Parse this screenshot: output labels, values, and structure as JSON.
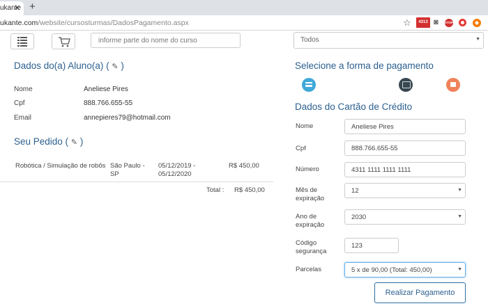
{
  "browser": {
    "tab_title": "ukante",
    "url_host": "ukante.com",
    "url_path": "/website/cursosturmas/DadosPagamento.aspx",
    "mail_badge": "4313"
  },
  "toolbar": {
    "search_placeholder": "informe parte do nome do curso",
    "filter_value": "Todos"
  },
  "student": {
    "title": "Dados do(a) Aluno(a) (",
    "title_end": ")",
    "name_label": "Nome",
    "name_value": "Aneliese Pires",
    "cpf_label": "Cpf",
    "cpf_value": "888.766.655-55",
    "email_label": "Email",
    "email_value": "annepieres79@hotmail.com"
  },
  "order": {
    "title": "Seu Pedido (",
    "title_end": ")",
    "course": "Robótica / Simulação de robôs",
    "city": "São Paulo - SP",
    "period": "05/12/2019 - 05/12/2020",
    "price": "R$ 450,00",
    "total_label": "Total :",
    "total_value": "R$ 450,00"
  },
  "payment": {
    "select_title": "Selecione a forma de pagamento",
    "card_title": "Dados do Cartão de Crédito",
    "name_label": "Nome",
    "name_value": "Aneliese Pires",
    "cpf_label": "Cpf",
    "cpf_value": "888.766.655-55",
    "number_label": "Número",
    "number_value": "4311 1111 1111 1111",
    "month_label": "Mês de expiração",
    "month_value": "12",
    "year_label": "Ano de expiração",
    "year_value": "2030",
    "cvv_label": "Código segurança",
    "cvv_value": "123",
    "installments_label": "Parcelas",
    "installments_value": "5 x de 90,00 (Total: 450,00)",
    "submit_label": "Realizar Pagamento"
  }
}
